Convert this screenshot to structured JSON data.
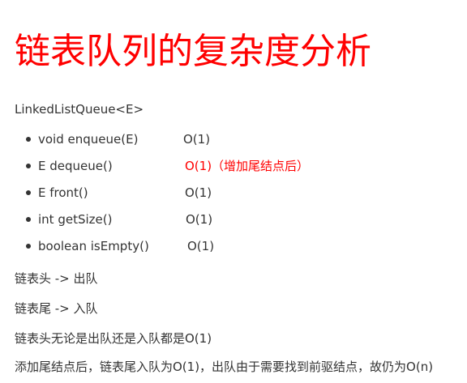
{
  "title": "链表队列的复杂度分析",
  "class_name": "LinkedListQueue<E>",
  "colors": {
    "accent": "#ff0000",
    "text": "#333333"
  },
  "methods": [
    {
      "signature": "void enqueue(E)",
      "complexity": "O(1)",
      "highlight": false
    },
    {
      "signature": "E dequeue()",
      "complexity": "O(1)（增加尾结点后）",
      "highlight": true
    },
    {
      "signature": "E front()",
      "complexity": "O(1)",
      "highlight": false
    },
    {
      "signature": "int getSize()",
      "complexity": "O(1)",
      "highlight": false
    },
    {
      "signature": "boolean isEmpty()",
      "complexity": "O(1)",
      "highlight": false
    }
  ],
  "notes": [
    "链表头 -> 出队",
    "链表尾 -> 入队",
    "链表头无论是出队还是入队都是O(1)",
    "添加尾结点后，链表尾入队为O(1)，出队由于需要找到前驱结点，故仍为O(n)"
  ]
}
